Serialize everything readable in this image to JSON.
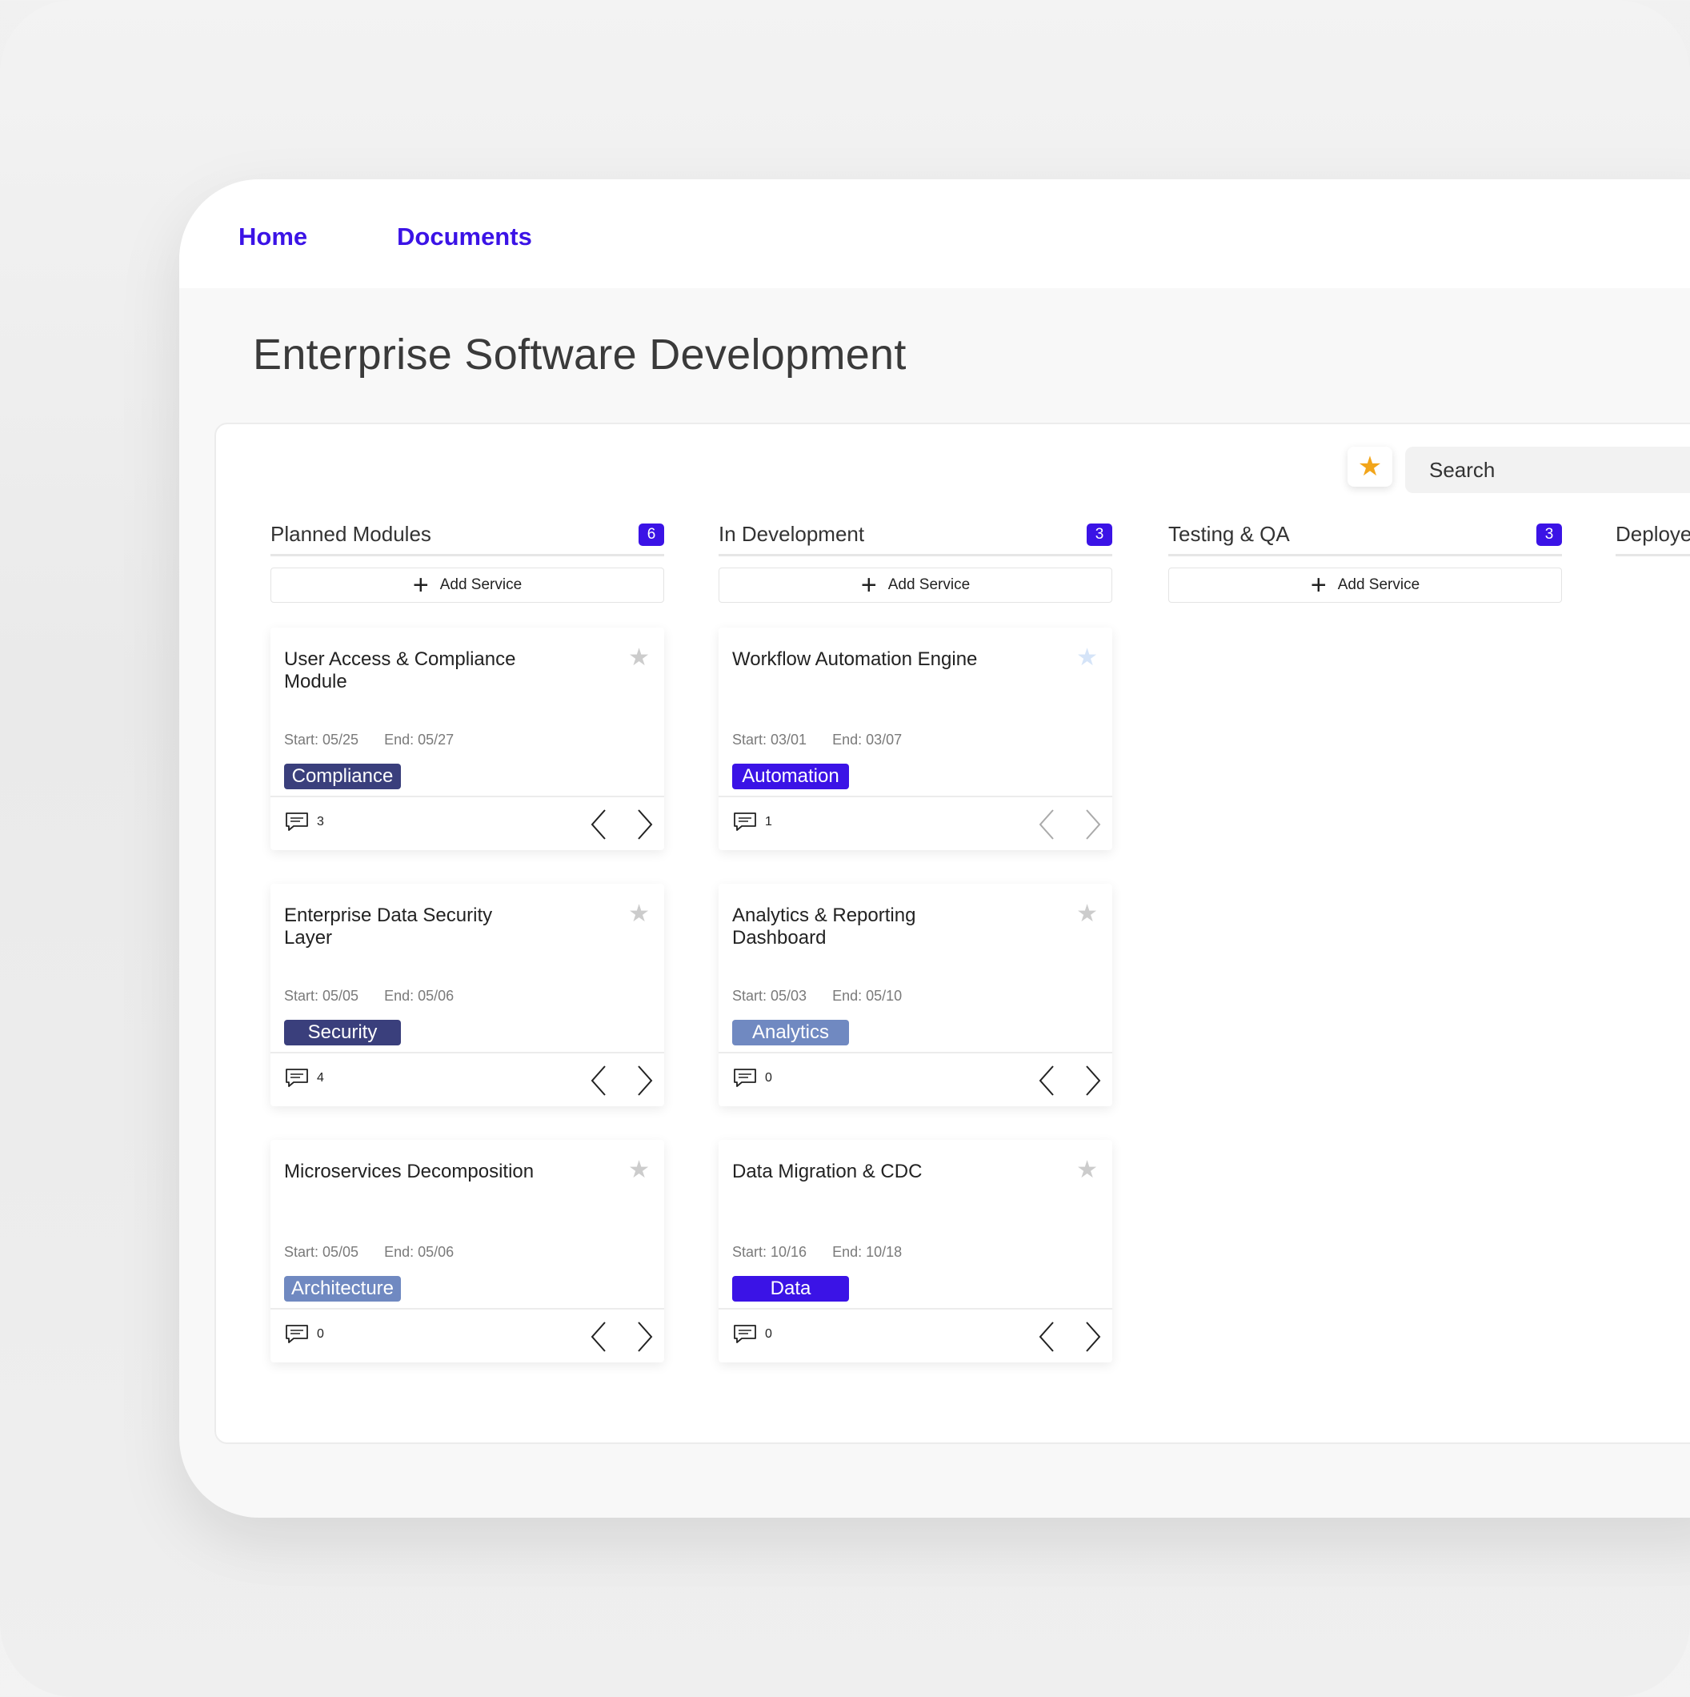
{
  "nav": {
    "home": "Home",
    "documents": "Documents"
  },
  "page": {
    "title": "Enterprise Software Development"
  },
  "toolbar": {
    "search_placeholder": "Search"
  },
  "colors": {
    "accent": "#3b13e6",
    "tag_compliance": "#3a3f7c",
    "tag_automation": "#3b13e6",
    "tag_security": "#3a3f7c",
    "tag_analytics": "#7089c1",
    "tag_architecture": "#7089c1",
    "tag_data": "#3b13e6",
    "star_favorite": "#f2a51a"
  },
  "columns": [
    {
      "title": "Planned Modules",
      "count": "6",
      "add_label": "Add Service",
      "cards": [
        {
          "title": "User Access & Compliance Module",
          "start": "Start: 05/25",
          "end": "End: 05/27",
          "tag": "Compliance",
          "comments": "3",
          "starred": false
        },
        {
          "title": "Enterprise Data Security Layer",
          "start": "Start: 05/05",
          "end": "End: 05/06",
          "tag": "Security",
          "comments": "4",
          "starred": false
        },
        {
          "title": "Microservices Decomposition",
          "start": "Start: 05/05",
          "end": "End: 05/06",
          "tag": "Architecture",
          "comments": "0",
          "starred": false
        }
      ]
    },
    {
      "title": "In Development",
      "count": "3",
      "add_label": "Add Service",
      "cards": [
        {
          "title": "Workflow Automation Engine",
          "start": "Start: 03/01",
          "end": "End: 03/07",
          "tag": "Automation",
          "comments": "1",
          "starred": false
        },
        {
          "title": "Analytics & Reporting Dashboard",
          "start": "Start: 05/03",
          "end": "End: 05/10",
          "tag": "Analytics",
          "comments": "0",
          "starred": false
        },
        {
          "title": "Data Migration & CDC",
          "start": "Start: 10/16",
          "end": "End: 10/18",
          "tag": "Data",
          "comments": "0",
          "starred": false
        }
      ]
    },
    {
      "title": "Testing & QA",
      "count": "3",
      "add_label": "Add Service",
      "cards": []
    },
    {
      "title": "Deploye",
      "count": "",
      "add_label": "",
      "cards": []
    }
  ]
}
